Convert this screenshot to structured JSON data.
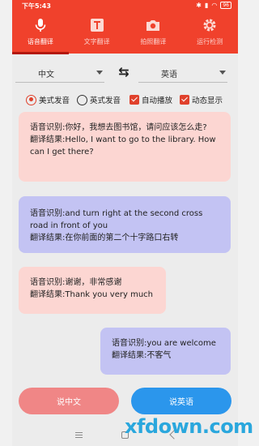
{
  "status": {
    "time": "下午5:43",
    "battery": "96"
  },
  "tabs": [
    {
      "label": "语音翻译",
      "icon": "microphone-icon",
      "active": true
    },
    {
      "label": "文字翻译",
      "icon": "text-icon",
      "active": false
    },
    {
      "label": "拍照翻译",
      "icon": "camera-icon",
      "active": false
    },
    {
      "label": "运行检测",
      "icon": "gear-icon",
      "active": false
    }
  ],
  "languages": {
    "source": "中文",
    "target": "英语",
    "swap_icon": "swap-icon"
  },
  "options": {
    "us_voice": "美式发音",
    "uk_voice": "英式发音",
    "auto_play": "自动播放",
    "dynamic_display": "动态显示"
  },
  "messages": [
    {
      "recognized": "语音识别:你好，我想去图书馆，请问应该怎么走?",
      "result": "翻译结果:Hello, I want to go to the library. How can I get there?"
    },
    {
      "recognized": "语音识别:and turn right at the second cross road in front of you",
      "result": "翻译结果:在你前面的第二个十字路口右转"
    },
    {
      "recognized": "语音识别:谢谢，非常感谢",
      "result": "翻译结果:Thank you very much"
    },
    {
      "recognized": "语音识别:you are welcome",
      "result": "翻译结果:不客气"
    }
  ],
  "buttons": {
    "speak_chinese": "说中文",
    "speak_english": "说英语"
  },
  "watermark": "xfdown.com",
  "colors": {
    "accent": "#f0412c",
    "pink_bubble": "#fcd6d2",
    "blue_bubble": "#c3c3f3",
    "blue_button": "#2b96ec",
    "pink_button": "#f08686"
  }
}
